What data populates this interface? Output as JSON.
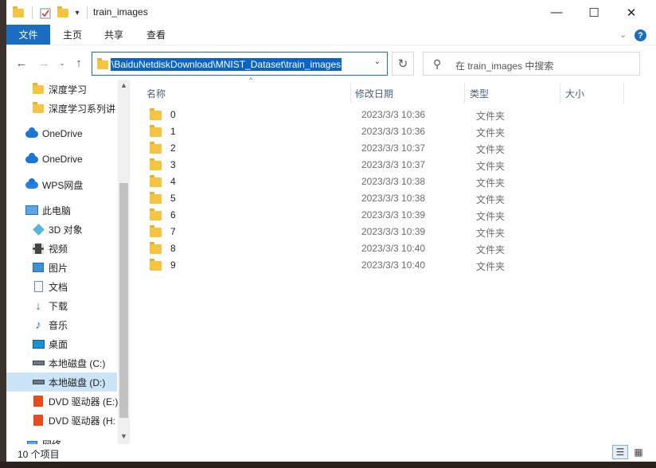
{
  "window": {
    "title": "train_images",
    "controls": {
      "minimize": "—",
      "maximize": "☐",
      "close": "✕"
    }
  },
  "ribbon": {
    "tabs": [
      "文件",
      "主页",
      "共享",
      "查看"
    ],
    "expand_icon": "chevron-down-icon",
    "help_label": "?"
  },
  "address": {
    "path": "\\BaiduNetdiskDownload\\MNIST_Dataset\\train_images",
    "search_placeholder": "在 train_images 中搜索"
  },
  "nav": {
    "items": [
      {
        "label": "深度学习",
        "icon": "folder-icon",
        "selected": false
      },
      {
        "label": "深度学习系列讲",
        "icon": "folder-icon",
        "selected": false
      },
      {
        "label": "OneDrive",
        "icon": "onedrive-icon",
        "selected": false
      },
      {
        "label": "OneDrive",
        "icon": "onedrive-icon",
        "selected": false
      },
      {
        "label": "WPS网盘",
        "icon": "wps-cloud-icon",
        "selected": false
      },
      {
        "label": "此电脑",
        "icon": "computer-icon",
        "selected": false
      },
      {
        "label": "3D 对象",
        "icon": "3d-objects-icon",
        "selected": false
      },
      {
        "label": "视频",
        "icon": "video-icon",
        "selected": false
      },
      {
        "label": "图片",
        "icon": "pictures-icon",
        "selected": false
      },
      {
        "label": "文档",
        "icon": "documents-icon",
        "selected": false
      },
      {
        "label": "下载",
        "icon": "download-icon",
        "selected": false
      },
      {
        "label": "音乐",
        "icon": "music-icon",
        "selected": false
      },
      {
        "label": "桌面",
        "icon": "desktop-icon",
        "selected": false
      },
      {
        "label": "本地磁盘 (C:)",
        "icon": "drive-icon",
        "selected": false
      },
      {
        "label": "本地磁盘 (D:)",
        "icon": "drive-icon",
        "selected": true
      },
      {
        "label": "DVD 驱动器 (E:)",
        "icon": "dvd-drive-icon",
        "selected": false
      },
      {
        "label": "DVD 驱动器 (H:",
        "icon": "dvd-drive-icon",
        "selected": false
      },
      {
        "label": "网络",
        "icon": "network-icon",
        "selected": false
      }
    ]
  },
  "files": {
    "columns": {
      "name": "名称",
      "date": "修改日期",
      "type": "类型",
      "size": "大小"
    },
    "rows": [
      {
        "name": "0",
        "date": "2023/3/3 10:36",
        "type": "文件夹"
      },
      {
        "name": "1",
        "date": "2023/3/3 10:36",
        "type": "文件夹"
      },
      {
        "name": "2",
        "date": "2023/3/3 10:37",
        "type": "文件夹"
      },
      {
        "name": "3",
        "date": "2023/3/3 10:37",
        "type": "文件夹"
      },
      {
        "name": "4",
        "date": "2023/3/3 10:38",
        "type": "文件夹"
      },
      {
        "name": "5",
        "date": "2023/3/3 10:38",
        "type": "文件夹"
      },
      {
        "name": "6",
        "date": "2023/3/3 10:39",
        "type": "文件夹"
      },
      {
        "name": "7",
        "date": "2023/3/3 10:39",
        "type": "文件夹"
      },
      {
        "name": "8",
        "date": "2023/3/3 10:40",
        "type": "文件夹"
      },
      {
        "name": "9",
        "date": "2023/3/3 10:40",
        "type": "文件夹"
      }
    ]
  },
  "status": {
    "count": "10 个项目"
  },
  "colors": {
    "accent": "#1a6dc0",
    "selection": "#0a64c8",
    "nav_selected": "#cce4f7",
    "folder": "#f5c542"
  }
}
